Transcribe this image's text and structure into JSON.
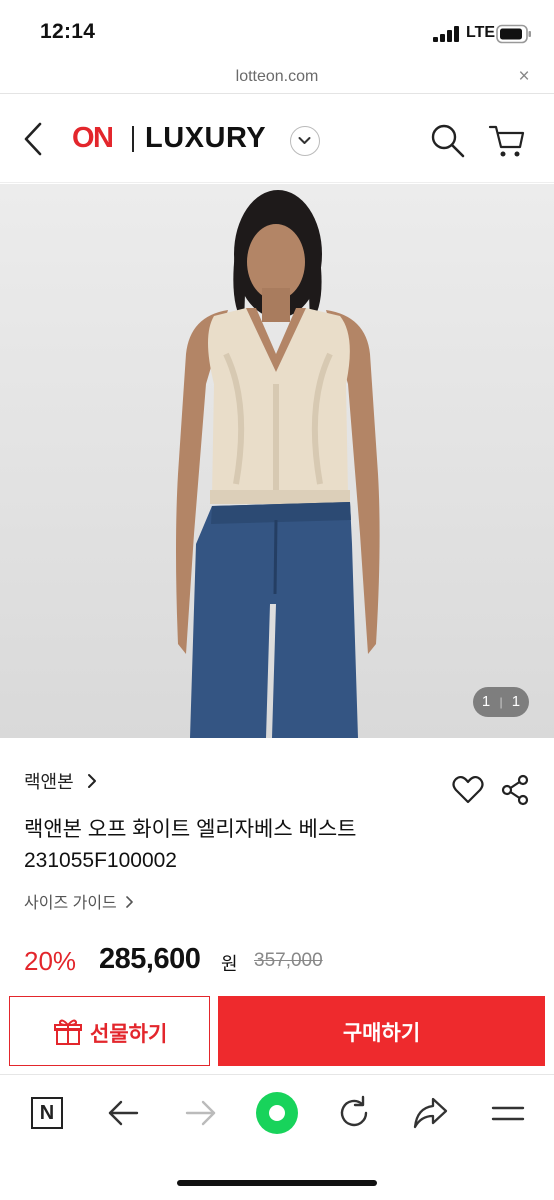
{
  "status_bar": {
    "time": "12:14",
    "network": "LTE"
  },
  "browser": {
    "url": "lotteon.com",
    "close_glyph": "×"
  },
  "header": {
    "logo_on": "ON",
    "logo_luxury": "LUXURY",
    "icons": [
      "back-chevron-icon",
      "dropdown-chevron-icon",
      "search-icon",
      "cart-icon"
    ]
  },
  "gallery": {
    "counter_current": "1",
    "counter_total": "1"
  },
  "product": {
    "brand": "랙앤본",
    "name_line1": "랙앤본 오프 화이트 엘리자베스 베스트",
    "name_line2": "231055F100002",
    "size_guide": "사이즈 가이드",
    "discount": "20%",
    "price": "285,600",
    "currency": "원",
    "original_price": "357,000"
  },
  "actions": {
    "gift_label": "선물하기",
    "buy_label": "구매하기"
  },
  "colors": {
    "accent": "#e3262c",
    "buy_button": "#ee2a2d",
    "home_button": "#18d35b"
  },
  "bottom_nav": {
    "n_label": "N",
    "icons": [
      "naver-n-icon",
      "back-arrow-icon",
      "forward-arrow-icon",
      "home-green-icon",
      "reload-icon",
      "share-arrow-icon",
      "menu-icon"
    ]
  }
}
